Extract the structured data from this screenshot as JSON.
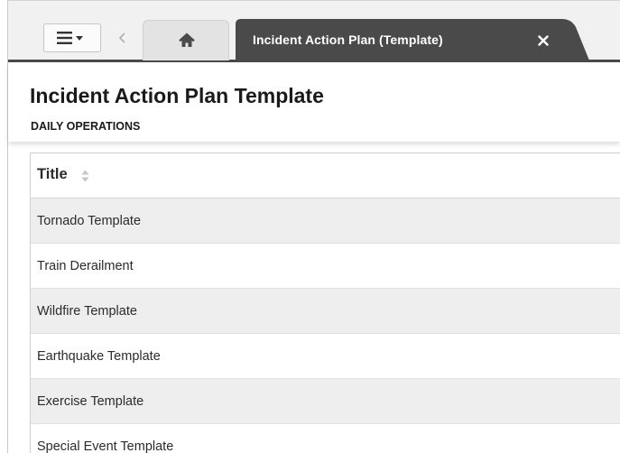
{
  "tabs": {
    "home_icon": "home-icon",
    "menu_icon": "hamburger-menu-icon",
    "active_tab_label": "Incident Action Plan (Template)",
    "close_icon": "close-icon"
  },
  "header": {
    "title": "Incident Action Plan Template",
    "subtitle": "DAILY OPERATIONS"
  },
  "table": {
    "column_header": "Title",
    "sort_icon": "sort-icon",
    "rows": [
      "Tornado Template",
      "Train Derailment",
      "Wildfire Template",
      "Earthquake Template",
      "Exercise Template",
      "Special Event Template"
    ]
  },
  "colors": {
    "active_tab": "#4a4a4a",
    "tabbar_bg": "#f1f1f1",
    "row_alt": "#eeeeee"
  }
}
